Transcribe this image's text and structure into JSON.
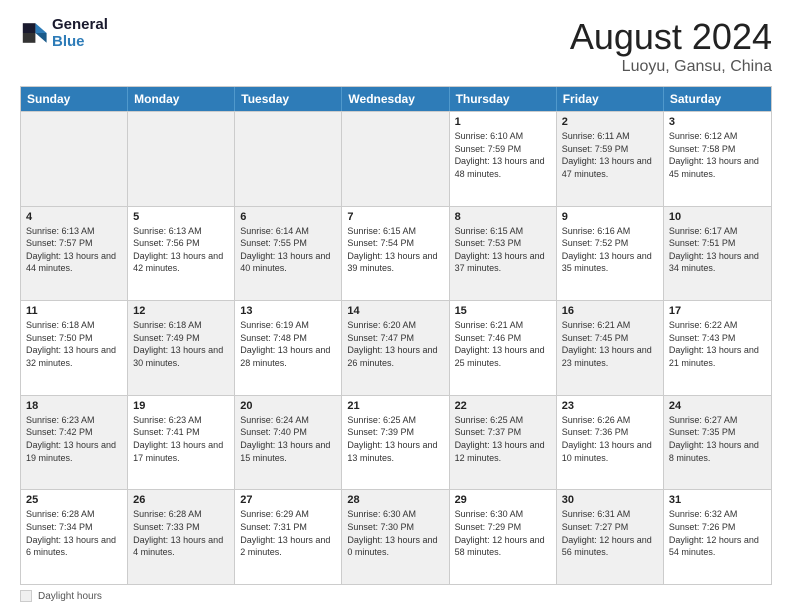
{
  "logo": {
    "line1": "General",
    "line2": "Blue"
  },
  "title": "August 2024",
  "location": "Luoyu, Gansu, China",
  "weekdays": [
    "Sunday",
    "Monday",
    "Tuesday",
    "Wednesday",
    "Thursday",
    "Friday",
    "Saturday"
  ],
  "weeks": [
    [
      {
        "day": "",
        "text": "",
        "shaded": true
      },
      {
        "day": "",
        "text": "",
        "shaded": true
      },
      {
        "day": "",
        "text": "",
        "shaded": true
      },
      {
        "day": "",
        "text": "",
        "shaded": true
      },
      {
        "day": "1",
        "text": "Sunrise: 6:10 AM\nSunset: 7:59 PM\nDaylight: 13 hours and 48 minutes."
      },
      {
        "day": "2",
        "text": "Sunrise: 6:11 AM\nSunset: 7:59 PM\nDaylight: 13 hours and 47 minutes.",
        "shaded": true
      },
      {
        "day": "3",
        "text": "Sunrise: 6:12 AM\nSunset: 7:58 PM\nDaylight: 13 hours and 45 minutes."
      }
    ],
    [
      {
        "day": "4",
        "text": "Sunrise: 6:13 AM\nSunset: 7:57 PM\nDaylight: 13 hours and 44 minutes.",
        "shaded": true
      },
      {
        "day": "5",
        "text": "Sunrise: 6:13 AM\nSunset: 7:56 PM\nDaylight: 13 hours and 42 minutes."
      },
      {
        "day": "6",
        "text": "Sunrise: 6:14 AM\nSunset: 7:55 PM\nDaylight: 13 hours and 40 minutes.",
        "shaded": true
      },
      {
        "day": "7",
        "text": "Sunrise: 6:15 AM\nSunset: 7:54 PM\nDaylight: 13 hours and 39 minutes."
      },
      {
        "day": "8",
        "text": "Sunrise: 6:15 AM\nSunset: 7:53 PM\nDaylight: 13 hours and 37 minutes.",
        "shaded": true
      },
      {
        "day": "9",
        "text": "Sunrise: 6:16 AM\nSunset: 7:52 PM\nDaylight: 13 hours and 35 minutes."
      },
      {
        "day": "10",
        "text": "Sunrise: 6:17 AM\nSunset: 7:51 PM\nDaylight: 13 hours and 34 minutes.",
        "shaded": true
      }
    ],
    [
      {
        "day": "11",
        "text": "Sunrise: 6:18 AM\nSunset: 7:50 PM\nDaylight: 13 hours and 32 minutes."
      },
      {
        "day": "12",
        "text": "Sunrise: 6:18 AM\nSunset: 7:49 PM\nDaylight: 13 hours and 30 minutes.",
        "shaded": true
      },
      {
        "day": "13",
        "text": "Sunrise: 6:19 AM\nSunset: 7:48 PM\nDaylight: 13 hours and 28 minutes."
      },
      {
        "day": "14",
        "text": "Sunrise: 6:20 AM\nSunset: 7:47 PM\nDaylight: 13 hours and 26 minutes.",
        "shaded": true
      },
      {
        "day": "15",
        "text": "Sunrise: 6:21 AM\nSunset: 7:46 PM\nDaylight: 13 hours and 25 minutes."
      },
      {
        "day": "16",
        "text": "Sunrise: 6:21 AM\nSunset: 7:45 PM\nDaylight: 13 hours and 23 minutes.",
        "shaded": true
      },
      {
        "day": "17",
        "text": "Sunrise: 6:22 AM\nSunset: 7:43 PM\nDaylight: 13 hours and 21 minutes."
      }
    ],
    [
      {
        "day": "18",
        "text": "Sunrise: 6:23 AM\nSunset: 7:42 PM\nDaylight: 13 hours and 19 minutes.",
        "shaded": true
      },
      {
        "day": "19",
        "text": "Sunrise: 6:23 AM\nSunset: 7:41 PM\nDaylight: 13 hours and 17 minutes."
      },
      {
        "day": "20",
        "text": "Sunrise: 6:24 AM\nSunset: 7:40 PM\nDaylight: 13 hours and 15 minutes.",
        "shaded": true
      },
      {
        "day": "21",
        "text": "Sunrise: 6:25 AM\nSunset: 7:39 PM\nDaylight: 13 hours and 13 minutes."
      },
      {
        "day": "22",
        "text": "Sunrise: 6:25 AM\nSunset: 7:37 PM\nDaylight: 13 hours and 12 minutes.",
        "shaded": true
      },
      {
        "day": "23",
        "text": "Sunrise: 6:26 AM\nSunset: 7:36 PM\nDaylight: 13 hours and 10 minutes."
      },
      {
        "day": "24",
        "text": "Sunrise: 6:27 AM\nSunset: 7:35 PM\nDaylight: 13 hours and 8 minutes.",
        "shaded": true
      }
    ],
    [
      {
        "day": "25",
        "text": "Sunrise: 6:28 AM\nSunset: 7:34 PM\nDaylight: 13 hours and 6 minutes."
      },
      {
        "day": "26",
        "text": "Sunrise: 6:28 AM\nSunset: 7:33 PM\nDaylight: 13 hours and 4 minutes.",
        "shaded": true
      },
      {
        "day": "27",
        "text": "Sunrise: 6:29 AM\nSunset: 7:31 PM\nDaylight: 13 hours and 2 minutes."
      },
      {
        "day": "28",
        "text": "Sunrise: 6:30 AM\nSunset: 7:30 PM\nDaylight: 13 hours and 0 minutes.",
        "shaded": true
      },
      {
        "day": "29",
        "text": "Sunrise: 6:30 AM\nSunset: 7:29 PM\nDaylight: 12 hours and 58 minutes."
      },
      {
        "day": "30",
        "text": "Sunrise: 6:31 AM\nSunset: 7:27 PM\nDaylight: 12 hours and 56 minutes.",
        "shaded": true
      },
      {
        "day": "31",
        "text": "Sunrise: 6:32 AM\nSunset: 7:26 PM\nDaylight: 12 hours and 54 minutes."
      }
    ]
  ],
  "footer": {
    "shaded_label": "Daylight hours"
  }
}
